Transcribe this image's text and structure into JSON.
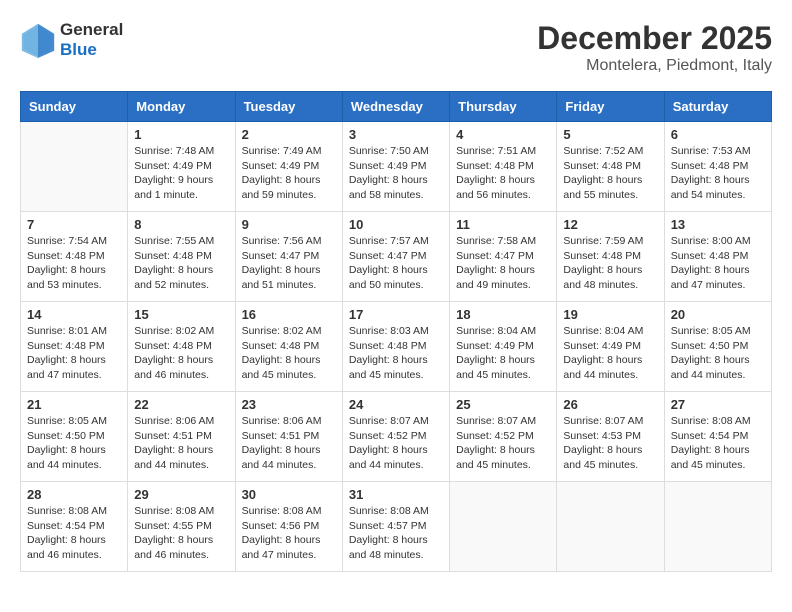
{
  "header": {
    "logo_line1": "General",
    "logo_line2": "Blue",
    "month_year": "December 2025",
    "location": "Montelera, Piedmont, Italy"
  },
  "weekdays": [
    "Sunday",
    "Monday",
    "Tuesday",
    "Wednesday",
    "Thursday",
    "Friday",
    "Saturday"
  ],
  "weeks": [
    [
      {
        "day": "",
        "text": ""
      },
      {
        "day": "1",
        "text": "Sunrise: 7:48 AM\nSunset: 4:49 PM\nDaylight: 9 hours\nand 1 minute."
      },
      {
        "day": "2",
        "text": "Sunrise: 7:49 AM\nSunset: 4:49 PM\nDaylight: 8 hours\nand 59 minutes."
      },
      {
        "day": "3",
        "text": "Sunrise: 7:50 AM\nSunset: 4:49 PM\nDaylight: 8 hours\nand 58 minutes."
      },
      {
        "day": "4",
        "text": "Sunrise: 7:51 AM\nSunset: 4:48 PM\nDaylight: 8 hours\nand 56 minutes."
      },
      {
        "day": "5",
        "text": "Sunrise: 7:52 AM\nSunset: 4:48 PM\nDaylight: 8 hours\nand 55 minutes."
      },
      {
        "day": "6",
        "text": "Sunrise: 7:53 AM\nSunset: 4:48 PM\nDaylight: 8 hours\nand 54 minutes."
      }
    ],
    [
      {
        "day": "7",
        "text": "Sunrise: 7:54 AM\nSunset: 4:48 PM\nDaylight: 8 hours\nand 53 minutes."
      },
      {
        "day": "8",
        "text": "Sunrise: 7:55 AM\nSunset: 4:48 PM\nDaylight: 8 hours\nand 52 minutes."
      },
      {
        "day": "9",
        "text": "Sunrise: 7:56 AM\nSunset: 4:47 PM\nDaylight: 8 hours\nand 51 minutes."
      },
      {
        "day": "10",
        "text": "Sunrise: 7:57 AM\nSunset: 4:47 PM\nDaylight: 8 hours\nand 50 minutes."
      },
      {
        "day": "11",
        "text": "Sunrise: 7:58 AM\nSunset: 4:47 PM\nDaylight: 8 hours\nand 49 minutes."
      },
      {
        "day": "12",
        "text": "Sunrise: 7:59 AM\nSunset: 4:48 PM\nDaylight: 8 hours\nand 48 minutes."
      },
      {
        "day": "13",
        "text": "Sunrise: 8:00 AM\nSunset: 4:48 PM\nDaylight: 8 hours\nand 47 minutes."
      }
    ],
    [
      {
        "day": "14",
        "text": "Sunrise: 8:01 AM\nSunset: 4:48 PM\nDaylight: 8 hours\nand 47 minutes."
      },
      {
        "day": "15",
        "text": "Sunrise: 8:02 AM\nSunset: 4:48 PM\nDaylight: 8 hours\nand 46 minutes."
      },
      {
        "day": "16",
        "text": "Sunrise: 8:02 AM\nSunset: 4:48 PM\nDaylight: 8 hours\nand 45 minutes."
      },
      {
        "day": "17",
        "text": "Sunrise: 8:03 AM\nSunset: 4:48 PM\nDaylight: 8 hours\nand 45 minutes."
      },
      {
        "day": "18",
        "text": "Sunrise: 8:04 AM\nSunset: 4:49 PM\nDaylight: 8 hours\nand 45 minutes."
      },
      {
        "day": "19",
        "text": "Sunrise: 8:04 AM\nSunset: 4:49 PM\nDaylight: 8 hours\nand 44 minutes."
      },
      {
        "day": "20",
        "text": "Sunrise: 8:05 AM\nSunset: 4:50 PM\nDaylight: 8 hours\nand 44 minutes."
      }
    ],
    [
      {
        "day": "21",
        "text": "Sunrise: 8:05 AM\nSunset: 4:50 PM\nDaylight: 8 hours\nand 44 minutes."
      },
      {
        "day": "22",
        "text": "Sunrise: 8:06 AM\nSunset: 4:51 PM\nDaylight: 8 hours\nand 44 minutes."
      },
      {
        "day": "23",
        "text": "Sunrise: 8:06 AM\nSunset: 4:51 PM\nDaylight: 8 hours\nand 44 minutes."
      },
      {
        "day": "24",
        "text": "Sunrise: 8:07 AM\nSunset: 4:52 PM\nDaylight: 8 hours\nand 44 minutes."
      },
      {
        "day": "25",
        "text": "Sunrise: 8:07 AM\nSunset: 4:52 PM\nDaylight: 8 hours\nand 45 minutes."
      },
      {
        "day": "26",
        "text": "Sunrise: 8:07 AM\nSunset: 4:53 PM\nDaylight: 8 hours\nand 45 minutes."
      },
      {
        "day": "27",
        "text": "Sunrise: 8:08 AM\nSunset: 4:54 PM\nDaylight: 8 hours\nand 45 minutes."
      }
    ],
    [
      {
        "day": "28",
        "text": "Sunrise: 8:08 AM\nSunset: 4:54 PM\nDaylight: 8 hours\nand 46 minutes."
      },
      {
        "day": "29",
        "text": "Sunrise: 8:08 AM\nSunset: 4:55 PM\nDaylight: 8 hours\nand 46 minutes."
      },
      {
        "day": "30",
        "text": "Sunrise: 8:08 AM\nSunset: 4:56 PM\nDaylight: 8 hours\nand 47 minutes."
      },
      {
        "day": "31",
        "text": "Sunrise: 8:08 AM\nSunset: 4:57 PM\nDaylight: 8 hours\nand 48 minutes."
      },
      {
        "day": "",
        "text": ""
      },
      {
        "day": "",
        "text": ""
      },
      {
        "day": "",
        "text": ""
      }
    ]
  ]
}
